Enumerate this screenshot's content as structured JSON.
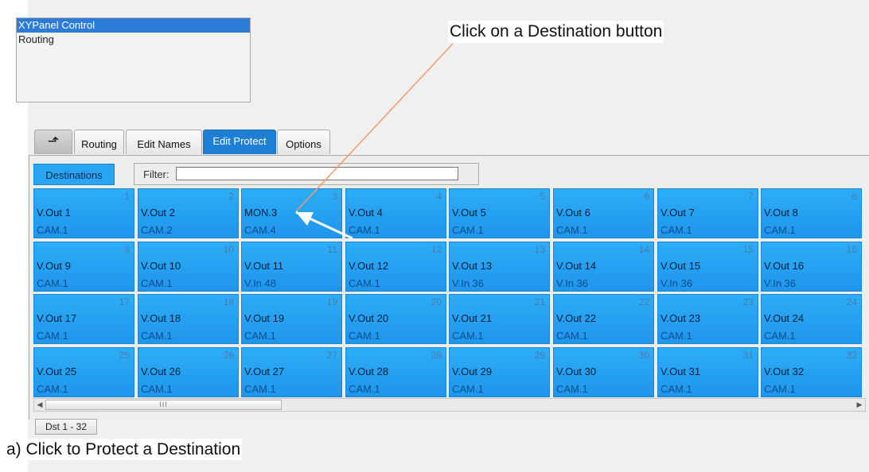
{
  "list": {
    "items": [
      "XYPanel Control",
      "Routing"
    ],
    "selected_index": 0
  },
  "tabs": [
    {
      "label": "",
      "icon": "return-arrow-icon"
    },
    {
      "label": "Routing"
    },
    {
      "label": "Edit Names"
    },
    {
      "label": "Edit Protect",
      "active": true
    },
    {
      "label": "Options"
    }
  ],
  "toolbar": {
    "destinations_label": "Destinations",
    "filter_label": "Filter:",
    "filter_value": ""
  },
  "cells": [
    {
      "num": "1",
      "name": "V.Out 1",
      "src": "CAM.1"
    },
    {
      "num": "2",
      "name": "V.Out 2",
      "src": "CAM.2"
    },
    {
      "num": "3",
      "name": "MON.3",
      "src": "CAM.4"
    },
    {
      "num": "4",
      "name": "V.Out 4",
      "src": "CAM.1"
    },
    {
      "num": "5",
      "name": "V.Out 5",
      "src": "CAM.1"
    },
    {
      "num": "6",
      "name": "V.Out 6",
      "src": "CAM.1"
    },
    {
      "num": "7",
      "name": "V.Out 7",
      "src": "CAM.1"
    },
    {
      "num": "8",
      "name": "V.Out 8",
      "src": "CAM.1"
    },
    {
      "num": "9",
      "name": "V.Out 9",
      "src": "CAM.1"
    },
    {
      "num": "10",
      "name": "V.Out 10",
      "src": "CAM.1"
    },
    {
      "num": "11",
      "name": "V.Out 11",
      "src": "V.In 48"
    },
    {
      "num": "12",
      "name": "V.Out 12",
      "src": "CAM.1"
    },
    {
      "num": "13",
      "name": "V.Out 13",
      "src": "V.In 36"
    },
    {
      "num": "14",
      "name": "V.Out 14",
      "src": "V.In 36"
    },
    {
      "num": "15",
      "name": "V.Out 15",
      "src": "V.In 36"
    },
    {
      "num": "16",
      "name": "V.Out 16",
      "src": "V.In 36"
    },
    {
      "num": "17",
      "name": "V.Out 17",
      "src": "CAM.1"
    },
    {
      "num": "18",
      "name": "V.Out 18",
      "src": "CAM.1"
    },
    {
      "num": "19",
      "name": "V.Out 19",
      "src": "CAM.1"
    },
    {
      "num": "20",
      "name": "V.Out 20",
      "src": "CAM.1"
    },
    {
      "num": "21",
      "name": "V.Out 21",
      "src": "CAM.1"
    },
    {
      "num": "22",
      "name": "V.Out 22",
      "src": "CAM.1"
    },
    {
      "num": "23",
      "name": "V.Out 23",
      "src": "CAM.1"
    },
    {
      "num": "24",
      "name": "V.Out 24",
      "src": "CAM.1"
    },
    {
      "num": "25",
      "name": "V.Out 25",
      "src": "CAM.1"
    },
    {
      "num": "26",
      "name": "V.Out 26",
      "src": "CAM.1"
    },
    {
      "num": "27",
      "name": "V.Out 27",
      "src": "CAM.1"
    },
    {
      "num": "28",
      "name": "V.Out 28",
      "src": "CAM.1"
    },
    {
      "num": "29",
      "name": "V.Out 29",
      "src": "CAM.1"
    },
    {
      "num": "30",
      "name": "V.Out 30",
      "src": "CAM.1"
    },
    {
      "num": "31",
      "name": "V.Out 31",
      "src": "CAM.1"
    },
    {
      "num": "32",
      "name": "V.Out 32",
      "src": "CAM.1"
    }
  ],
  "scrollbar": {
    "thumb_grip": "III"
  },
  "page_tab": "Dst 1 - 32",
  "annotations": {
    "callout": "Click on a Destination button",
    "caption": "a) Click to Protect a Destination"
  },
  "colors": {
    "accent": "#1e7fd4",
    "cell": "#2aa5f2",
    "callout_line": "#f29a66"
  }
}
